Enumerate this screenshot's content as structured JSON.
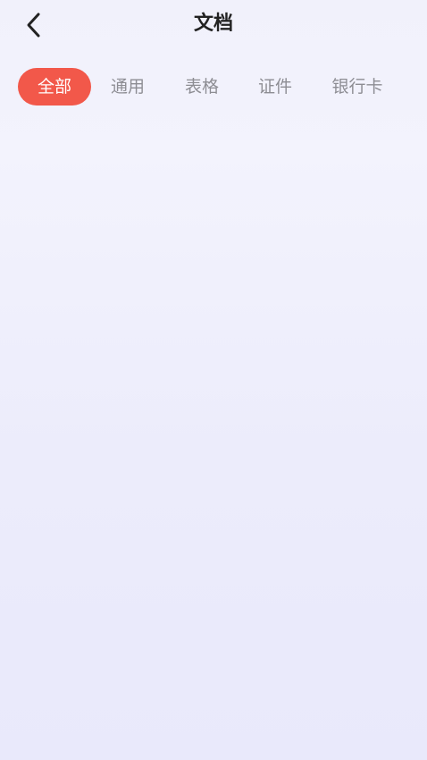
{
  "header": {
    "title": "文档",
    "back_icon": "chevron-left-icon"
  },
  "tabs": [
    {
      "label": "全部",
      "active": true
    },
    {
      "label": "通用",
      "active": false
    },
    {
      "label": "表格",
      "active": false
    },
    {
      "label": "证件",
      "active": false
    },
    {
      "label": "银行卡",
      "active": false
    }
  ],
  "colors": {
    "accent": "#f2584a",
    "title": "#222222",
    "tab_inactive": "#8d8d93"
  }
}
